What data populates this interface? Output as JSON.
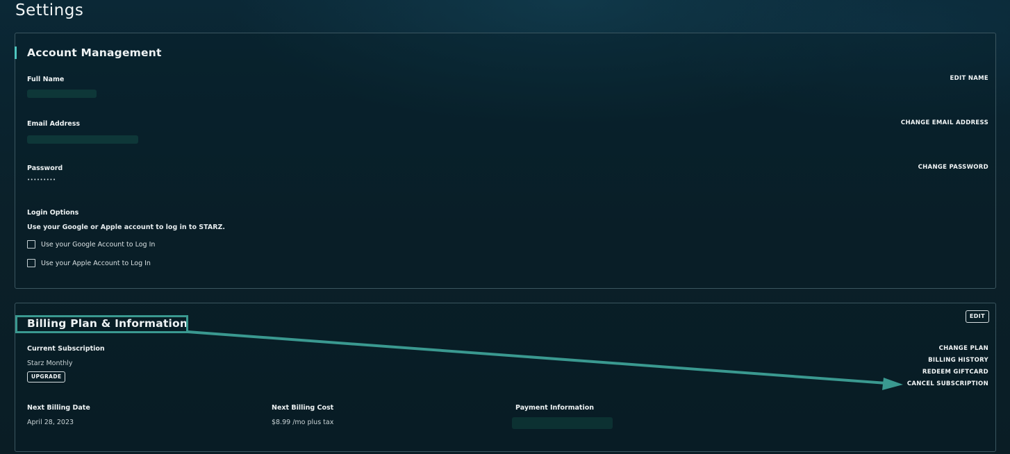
{
  "page": {
    "title": "Settings"
  },
  "account": {
    "title": "Account Management",
    "full_name_label": "Full Name",
    "edit_name": "EDIT NAME",
    "email_label": "Email Address",
    "change_email": "CHANGE EMAIL ADDRESS",
    "password_label": "Password",
    "password_value": "•••••••••",
    "change_password": "CHANGE PASSWORD",
    "login_options_label": "Login Options",
    "login_options_desc": "Use your Google or Apple account to log in to STARZ.",
    "google_option": "Use your Google Account to Log In",
    "apple_option": "Use your Apple Account to Log In"
  },
  "billing": {
    "title": "Billing Plan & Information",
    "edit_button": "EDIT",
    "current_subscription_label": "Current Subscription",
    "current_subscription_value": "Starz Monthly",
    "upgrade_button": "UPGRADE",
    "change_plan": "CHANGE PLAN",
    "billing_history": "BILLING HISTORY",
    "redeem_giftcard": "REDEEM GIFTCARD",
    "cancel_subscription": "CANCEL SUBSCRIPTION",
    "next_billing_date_label": "Next Billing Date",
    "next_billing_date_value": "April 28, 2023",
    "next_billing_cost_label": "Next Billing Cost",
    "next_billing_cost_value": "$8.99 /mo plus tax",
    "payment_info_label": "Payment Information"
  },
  "colors": {
    "accent": "#4fc6c0",
    "annotation": "#3a9990",
    "panel_border": "#3b5660"
  }
}
